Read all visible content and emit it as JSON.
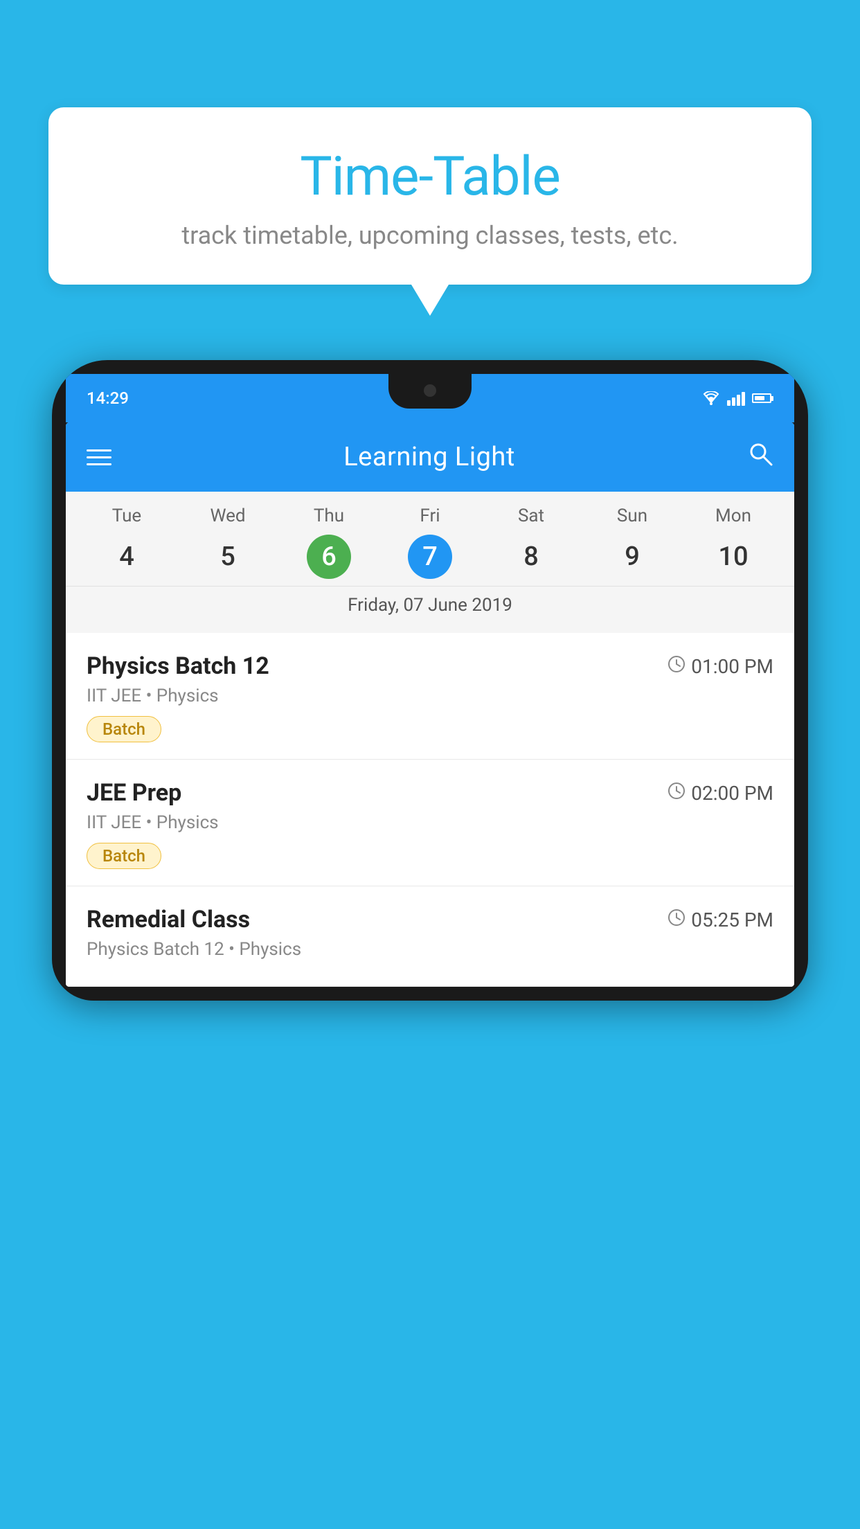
{
  "background_color": "#29B6E8",
  "speech_bubble": {
    "title": "Time-Table",
    "subtitle": "track timetable, upcoming classes, tests, etc."
  },
  "phone": {
    "status_bar": {
      "time": "14:29"
    },
    "app_bar": {
      "title": "Learning Light"
    },
    "calendar": {
      "days": [
        {
          "label": "Tue",
          "number": "4",
          "state": "normal"
        },
        {
          "label": "Wed",
          "number": "5",
          "state": "normal"
        },
        {
          "label": "Thu",
          "number": "6",
          "state": "today"
        },
        {
          "label": "Fri",
          "number": "7",
          "state": "selected"
        },
        {
          "label": "Sat",
          "number": "8",
          "state": "normal"
        },
        {
          "label": "Sun",
          "number": "9",
          "state": "normal"
        },
        {
          "label": "Mon",
          "number": "10",
          "state": "normal"
        }
      ],
      "selected_date_label": "Friday, 07 June 2019"
    },
    "schedule_items": [
      {
        "title": "Physics Batch 12",
        "time": "01:00 PM",
        "subtitle": "IIT JEE • Physics",
        "tag": "Batch"
      },
      {
        "title": "JEE Prep",
        "time": "02:00 PM",
        "subtitle": "IIT JEE • Physics",
        "tag": "Batch"
      },
      {
        "title": "Remedial Class",
        "time": "05:25 PM",
        "subtitle": "Physics Batch 12 • Physics",
        "tag": null
      }
    ]
  }
}
